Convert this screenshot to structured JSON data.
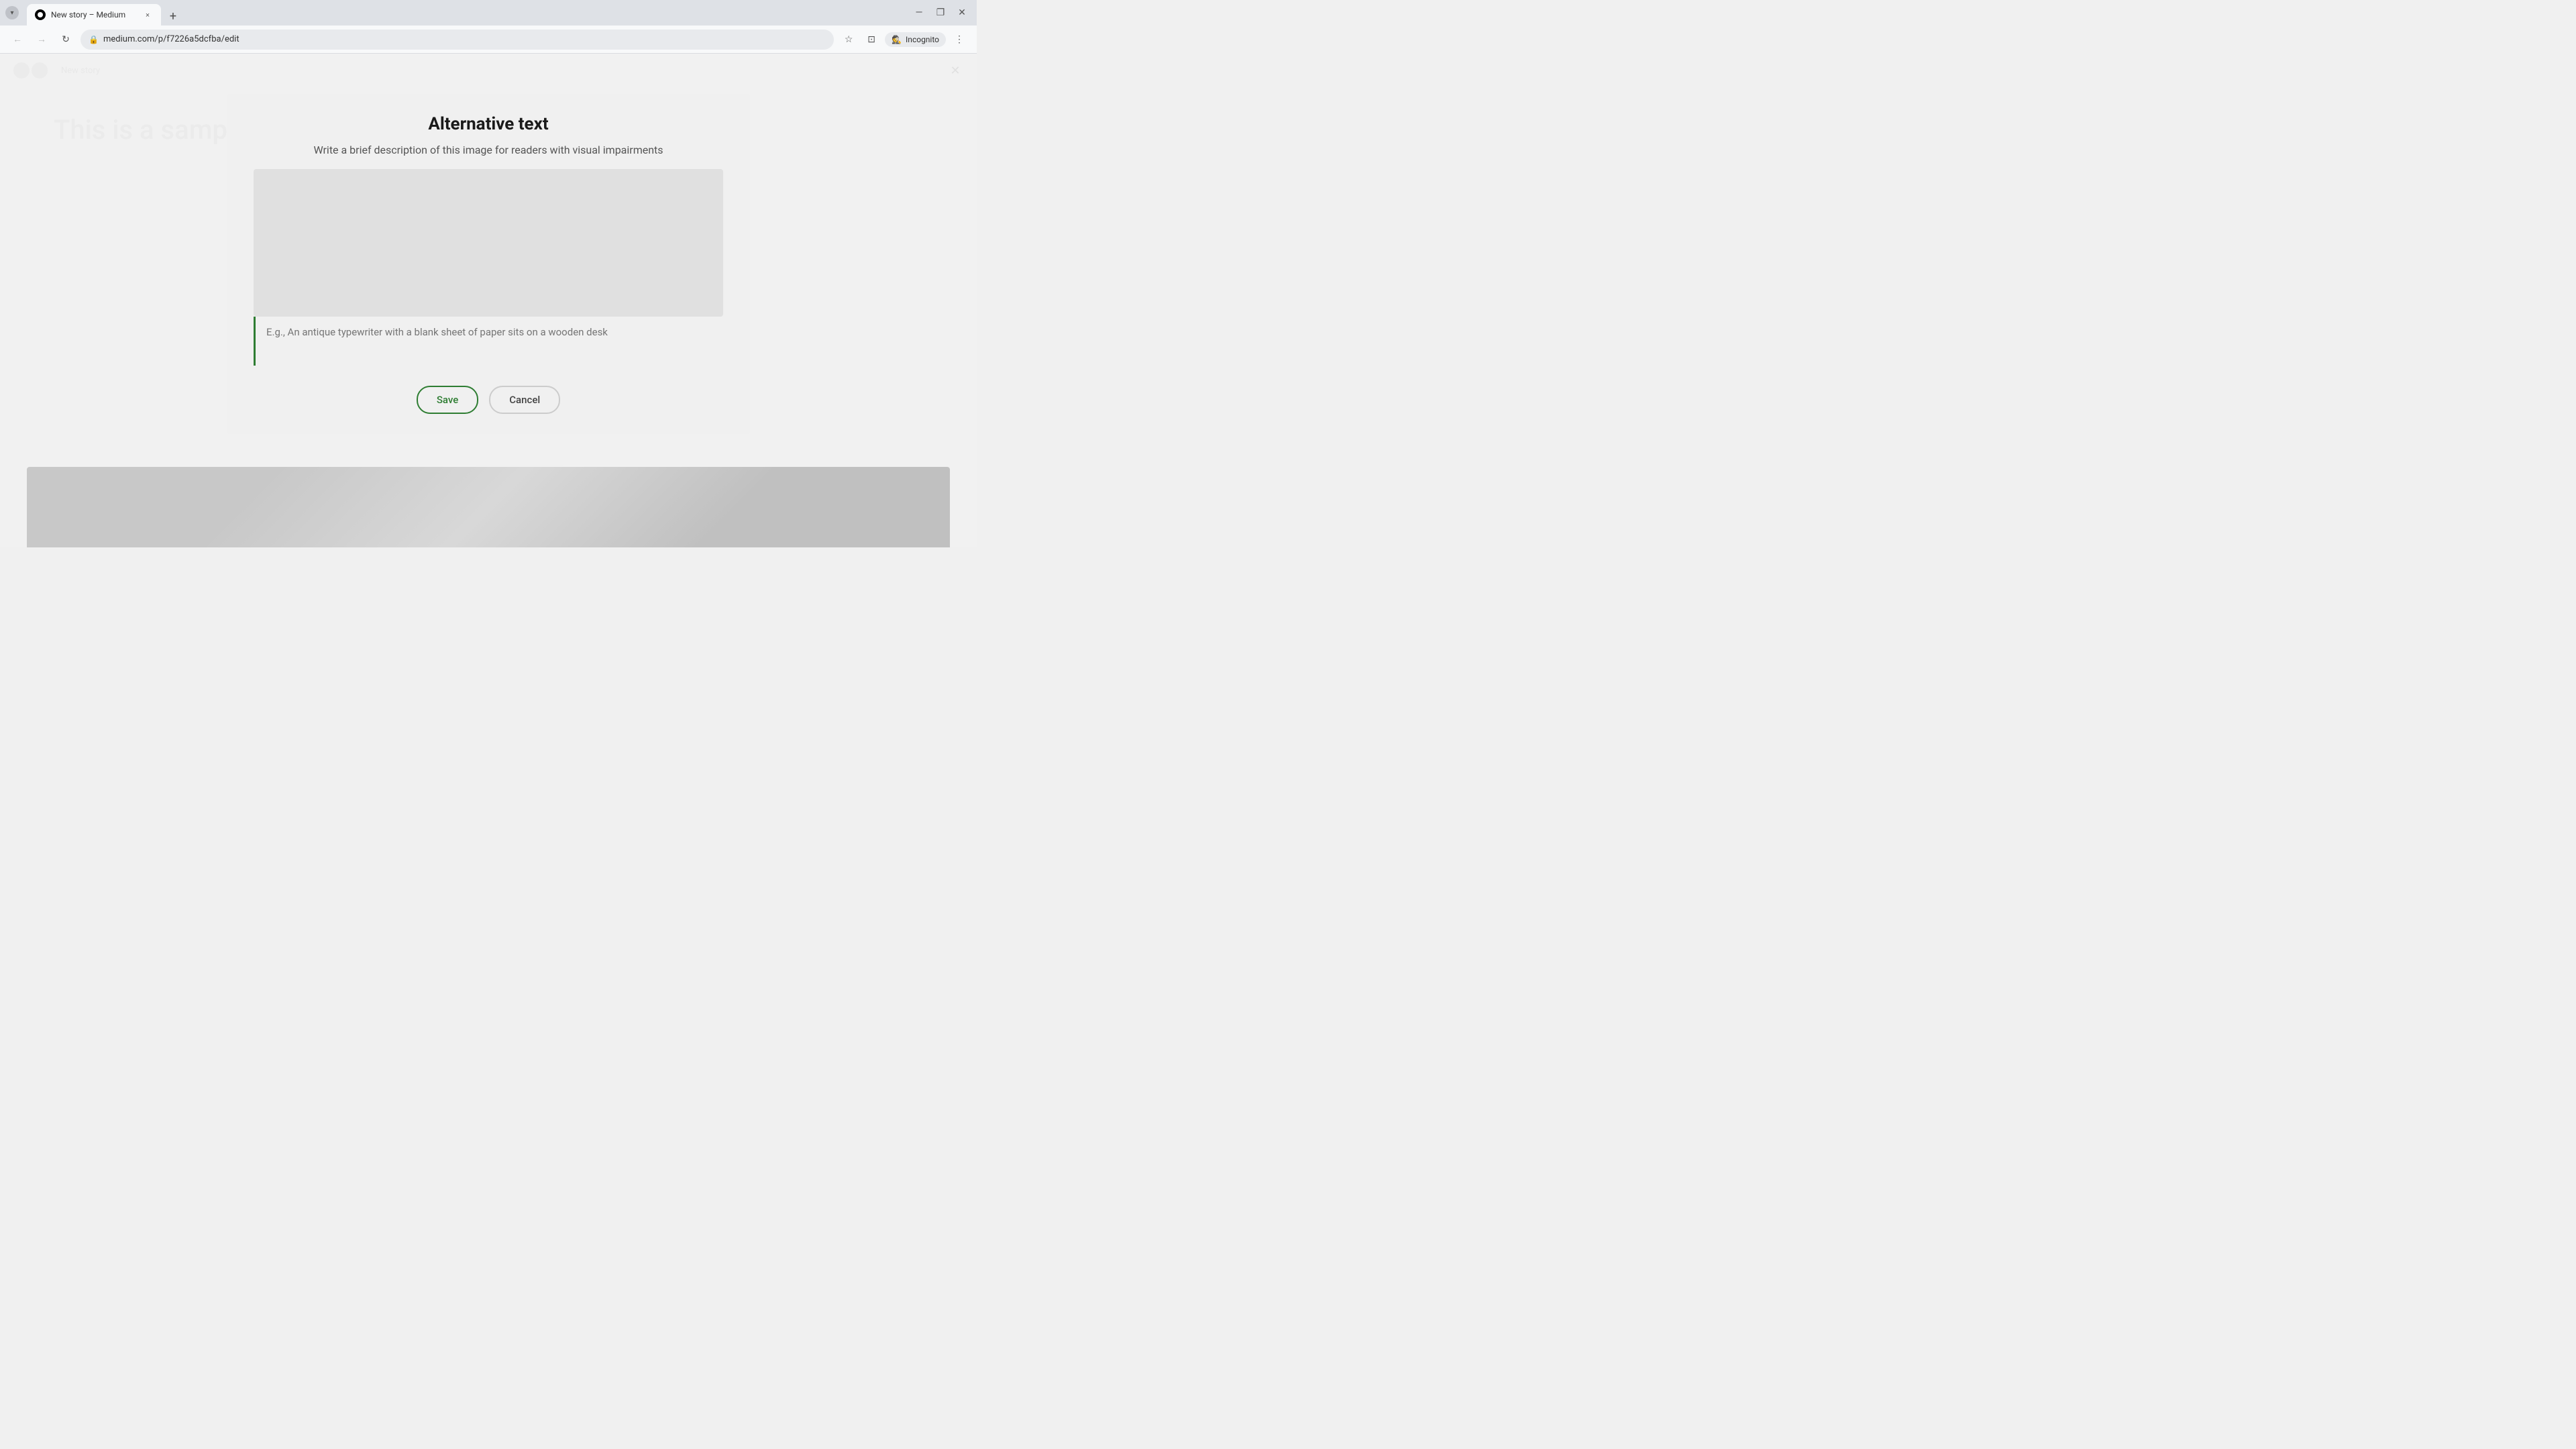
{
  "browser": {
    "tab": {
      "favicon_label": "Medium favicon",
      "title": "New story – Medium",
      "close_label": "×"
    },
    "new_tab_label": "+",
    "window_buttons": {
      "minimize": "—",
      "maximize": "❐",
      "close": "✕"
    },
    "nav": {
      "back_label": "←",
      "forward_label": "→",
      "reload_label": "↻"
    },
    "url": "medium.com/p/f7226a5dcfba/edit",
    "address_actions": {
      "bookmark": "☆",
      "split": "⊡",
      "incognito_label": "Incognito",
      "more": "⋮"
    }
  },
  "editor": {
    "logo_label": "Medium logo",
    "header_nav_text": "New story",
    "close_label": "✕",
    "title_placeholder": "This is a samp...",
    "content_placeholder": ""
  },
  "modal": {
    "title": "Alternative text",
    "subtitle": "Write a brief description of this image for readers with visual impairments",
    "input_placeholder": "E.g., An antique typewriter with a blank sheet of paper sits on a wooden desk",
    "save_label": "Save",
    "cancel_label": "Cancel"
  }
}
